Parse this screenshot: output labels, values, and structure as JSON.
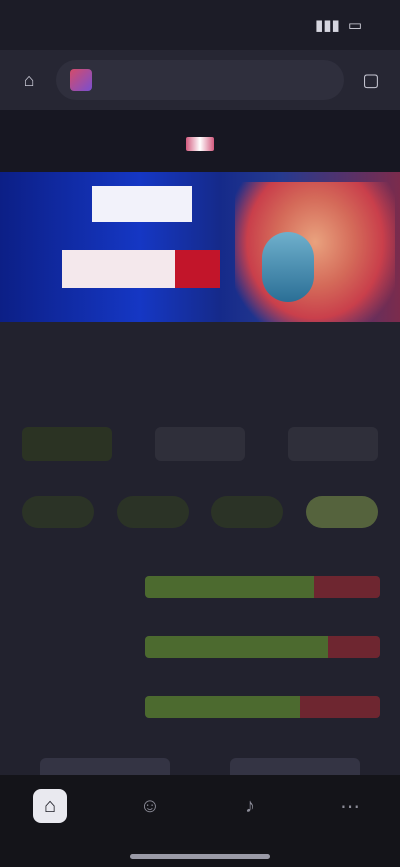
{
  "status_bar": {
    "time": "",
    "battery": ""
  },
  "url_bar": {
    "url": ""
  },
  "match": {
    "title": ""
  },
  "banner": {
    "top_text": "",
    "bottom_text": ""
  },
  "fighters": {
    "left": "",
    "right": ""
  },
  "odds": [
    {
      "value": ""
    },
    {
      "value": ""
    },
    {
      "value": ""
    }
  ],
  "tabs": [
    {
      "label": ""
    },
    {
      "label": ""
    },
    {
      "label": ""
    },
    {
      "label": ""
    }
  ],
  "stats": [
    {
      "label": "",
      "left_share": 0.72
    },
    {
      "label": "",
      "left_share": 0.78
    },
    {
      "label": "",
      "left_share": 0.66
    }
  ],
  "footer": {
    "left_button": "",
    "right_button": ""
  },
  "nav": [
    {
      "label": "",
      "icon": "home-icon",
      "active": true
    },
    {
      "label": "",
      "icon": "user-icon",
      "active": false
    },
    {
      "label": "",
      "icon": "bell-icon",
      "active": false
    },
    {
      "label": "",
      "icon": "more-icon",
      "active": false
    }
  ],
  "colors": {
    "accent_green": "#a7d86a",
    "bar_green": "#4c6a2f",
    "bar_red": "#6e2630",
    "background": "#22222e"
  }
}
